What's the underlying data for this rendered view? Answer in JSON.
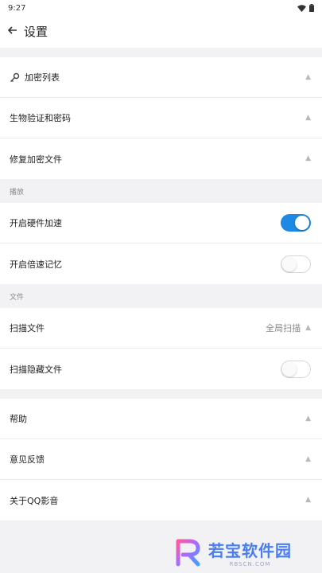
{
  "status": {
    "time": "9:27"
  },
  "header": {
    "title": "设置",
    "back_icon": "back-arrow-icon"
  },
  "group_top": [
    {
      "label": "加密列表",
      "icon": "key-icon"
    },
    {
      "label": "生物验证和密码"
    },
    {
      "label": "修复加密文件"
    }
  ],
  "playback": {
    "header": "播放",
    "items": [
      {
        "label": "开启硬件加速",
        "toggle": true
      },
      {
        "label": "开启倍速记忆",
        "toggle": false
      }
    ]
  },
  "files": {
    "header": "文件",
    "scan": {
      "label": "扫描文件",
      "value": "全局扫描"
    },
    "hidden": {
      "label": "扫描隐藏文件",
      "toggle": false
    }
  },
  "group_bottom": [
    {
      "label": "帮助"
    },
    {
      "label": "意见反馈"
    },
    {
      "label": "关于QQ影音"
    }
  ],
  "watermark": {
    "title": "若宝软件园",
    "subtitle": "RBSCN.COM"
  },
  "colors": {
    "accent": "#1e88e5",
    "watermark": "#4a7df0"
  }
}
